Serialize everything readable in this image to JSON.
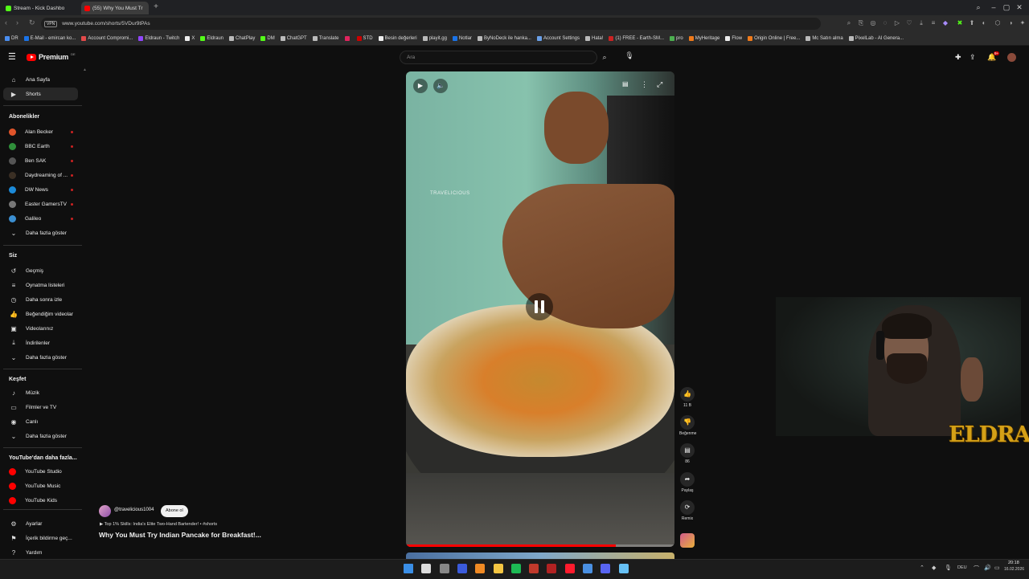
{
  "browser": {
    "tabs": [
      {
        "label": "Stream - Kick Dashbo",
        "active": false,
        "favicon_color": "#53fc18"
      },
      {
        "label": "(55) Why You Must Tr",
        "active": true,
        "favicon_color": "#ff0000"
      }
    ],
    "new_tab": "+",
    "vpn_label": "VPN",
    "url": "www.youtube.com/shorts/5VDur9tPAs",
    "bookmarks": [
      {
        "label": "DR",
        "color": "#4a8ef0"
      },
      {
        "label": "E-Mail - emircan ko...",
        "color": "#1a73e8"
      },
      {
        "label": "Account Compromi...",
        "color": "#e34a4a"
      },
      {
        "label": "Eldraun - Twitch",
        "color": "#9146ff"
      },
      {
        "label": "X",
        "color": "#eeeeee"
      },
      {
        "label": "Eldraun",
        "color": "#53fc18"
      },
      {
        "label": "ChatPlay",
        "color": "#bbbbbb"
      },
      {
        "label": "DM",
        "color": "#53fc18"
      },
      {
        "label": "ChatGPT",
        "color": "#bbbbbb"
      },
      {
        "label": "Translate",
        "color": "#bbbbbb"
      },
      {
        "label": "",
        "color": "#e0245e"
      },
      {
        "label": "STD",
        "color": "#cc0000"
      },
      {
        "label": "Besin değerleri",
        "color": "#eeeeee"
      },
      {
        "label": "playit.gg",
        "color": "#bbbbbb"
      },
      {
        "label": "Notlar",
        "color": "#1a73e8"
      },
      {
        "label": "ByNoDeck ile hanka...",
        "color": "#bbbbbb"
      },
      {
        "label": "Account Settings",
        "color": "#6aa0e8"
      },
      {
        "label": "Hata!",
        "color": "#bbbbbb"
      },
      {
        "label": "(1) FREE - Earth-SM...",
        "color": "#cc2222"
      },
      {
        "label": "pro",
        "color": "#4caf50"
      },
      {
        "label": "MyHeritage",
        "color": "#f07a1a"
      },
      {
        "label": "Flow",
        "color": "#eeeeee"
      },
      {
        "label": "Origin Online | Free...",
        "color": "#f07a1a"
      },
      {
        "label": "Mc Satın alma",
        "color": "#bbbbbb"
      },
      {
        "label": "PixelLab - AI Genera...",
        "color": "#bbbbbb"
      }
    ]
  },
  "header": {
    "logo_text": "Premium",
    "logo_sup": "DE",
    "search_placeholder": "Ara",
    "notification_count": "9+"
  },
  "sidebar": {
    "top": [
      {
        "label": "Ana Sayfa",
        "icon": "home-icon",
        "glyph": "⌂"
      },
      {
        "label": "Shorts",
        "icon": "shorts-icon",
        "glyph": "▶"
      }
    ],
    "subs_title": "Abonelikler",
    "subs": [
      {
        "label": "Alan Becker",
        "color": "#e0542a"
      },
      {
        "label": "BBC Earth",
        "color": "#2f8f3a"
      },
      {
        "label": "Ben SAK",
        "color": "#555555"
      },
      {
        "label": "Daydreaming of ...",
        "color": "#3a2f24"
      },
      {
        "label": "DW News",
        "color": "#1c8ad8"
      },
      {
        "label": "Easter GamersTV",
        "color": "#777777"
      },
      {
        "label": "Galileo",
        "color": "#3b8ed0"
      }
    ],
    "subs_more": "Daha fazla göster",
    "you_title": "Siz",
    "you": [
      {
        "label": "Geçmiş",
        "icon": "history-icon",
        "glyph": "↺"
      },
      {
        "label": "Oynatma listeleri",
        "icon": "playlists-icon",
        "glyph": "≡"
      },
      {
        "label": "Daha sonra izle",
        "icon": "watch-later-icon",
        "glyph": "◷"
      },
      {
        "label": "Beğendiğim videolar",
        "icon": "like-icon",
        "glyph": "👍"
      },
      {
        "label": "Videolarınız",
        "icon": "your-videos-icon",
        "glyph": "▣"
      },
      {
        "label": "İndirilenler",
        "icon": "download-icon",
        "glyph": "⤓"
      }
    ],
    "you_more": "Daha fazla göster",
    "explore_title": "Keşfet",
    "explore": [
      {
        "label": "Müzik",
        "icon": "music-icon",
        "glyph": "♪"
      },
      {
        "label": "Filmler ve TV",
        "icon": "film-icon",
        "glyph": "▭"
      },
      {
        "label": "Canlı",
        "icon": "live-icon",
        "glyph": "◉"
      }
    ],
    "explore_more": "Daha fazla göster",
    "more_title": "YouTube'dan daha fazla...",
    "more": [
      {
        "label": "YouTube Studio",
        "color": "#ff0000"
      },
      {
        "label": "YouTube Music",
        "color": "#ff0000"
      },
      {
        "label": "YouTube Kids",
        "color": "#ff0000"
      }
    ],
    "settings": [
      {
        "label": "Ayarlar",
        "icon": "settings-icon",
        "glyph": "⚙"
      },
      {
        "label": "İçerik bildirme geç...",
        "icon": "flag-icon",
        "glyph": "⚑"
      },
      {
        "label": "Yardım",
        "icon": "help-icon",
        "glyph": "?"
      }
    ]
  },
  "video": {
    "watermark": "TRAVELICIOUS",
    "progress": 0.78
  },
  "actions": {
    "like_count": "11 B",
    "dislike_label": "Beğenme",
    "comments_count": "86",
    "share_label": "Paylaş",
    "remix_label": "Remix"
  },
  "info": {
    "channel": "@travelicious1004",
    "subscribe": "Abone ol",
    "music": "Top 1% Skills: India's Elite Two-Hand Bartender! • #shorts",
    "title": "Why You Must Try Indian Pancake for Breakfast!..."
  },
  "overlay": {
    "streamer_logo": "ELDRAUN"
  },
  "taskbar": {
    "apps": [
      {
        "name": "start",
        "color": "#3a8ee6"
      },
      {
        "name": "task-view",
        "color": "#dddddd"
      },
      {
        "name": "settings",
        "color": "#888888"
      },
      {
        "name": "app-blue",
        "color": "#3b5bdb"
      },
      {
        "name": "vlc",
        "color": "#f08a24"
      },
      {
        "name": "explorer",
        "color": "#f4c542"
      },
      {
        "name": "spotify",
        "color": "#1db954"
      },
      {
        "name": "app-red",
        "color": "#c0392b"
      },
      {
        "name": "app-dark",
        "color": "#b22222"
      },
      {
        "name": "opera",
        "color": "#ff1b2d"
      },
      {
        "name": "app-circle",
        "color": "#4a90e2"
      },
      {
        "name": "discord",
        "color": "#5865f2"
      },
      {
        "name": "steam",
        "color": "#66c0f4"
      }
    ],
    "lang": "DEU",
    "time": "20:18",
    "date": "16.02.2026"
  }
}
